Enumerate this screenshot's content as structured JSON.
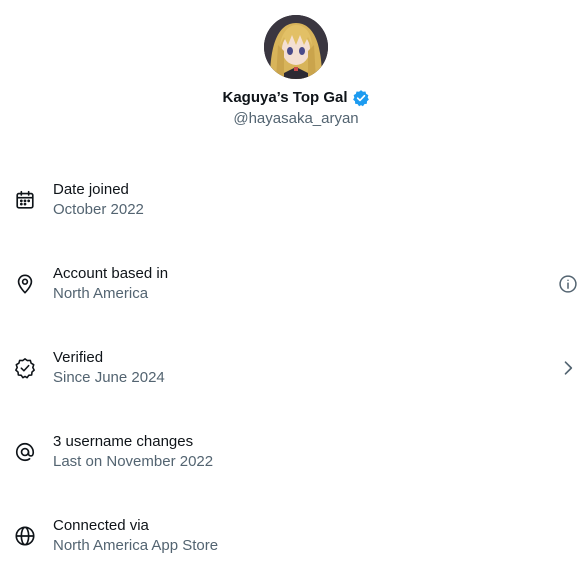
{
  "profile": {
    "display_name": "Kaguya’s Top Gal",
    "handle": "@hayasaka_aryan",
    "verified": true,
    "badge_color": "#1d9bf0"
  },
  "rows": [
    {
      "icon": "calendar-icon",
      "title": "Date joined",
      "subtitle": "October 2022",
      "trailing": null
    },
    {
      "icon": "location-pin-icon",
      "title": "Account based in",
      "subtitle": "North America",
      "trailing": "info-icon"
    },
    {
      "icon": "verified-check-icon",
      "title": "Verified",
      "subtitle": "Since June 2024",
      "trailing": "chevron-right-icon"
    },
    {
      "icon": "at-sign-icon",
      "title": "3 username changes",
      "subtitle": "Last on November 2022",
      "trailing": null
    },
    {
      "icon": "globe-icon",
      "title": "Connected via",
      "subtitle": "North America App Store",
      "trailing": null
    }
  ],
  "colors": {
    "primary_text": "#0f1419",
    "secondary_text": "#536471",
    "background": "#ffffff"
  }
}
